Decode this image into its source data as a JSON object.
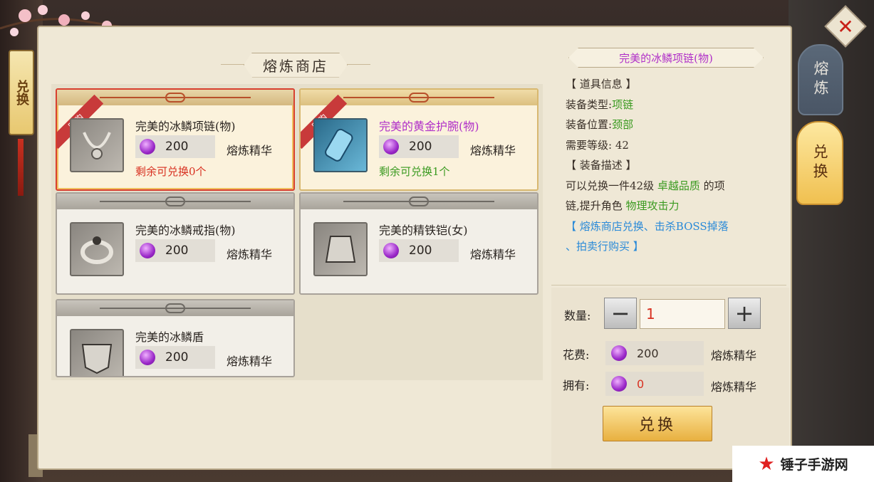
{
  "shop": {
    "title": "熔炼商店",
    "limited_tag": "限购",
    "items": [
      {
        "name": "完美的冰鳞项链(物)",
        "price": "200",
        "currency": "熔炼精华",
        "remaining": "剩余可兑换0个",
        "limited": true,
        "selected": true,
        "name_color": "normal",
        "remain_color": "red"
      },
      {
        "name": "完美的黄金护腕(物)",
        "price": "200",
        "currency": "熔炼精华",
        "remaining": "剩余可兑换1个",
        "limited": true,
        "selected": false,
        "name_color": "purple",
        "remain_color": "green"
      },
      {
        "name": "完美的冰鳞戒指(物)",
        "price": "200",
        "currency": "熔炼精华",
        "remaining": "",
        "limited": false
      },
      {
        "name": "完美的精铁铠(女)",
        "price": "200",
        "currency": "熔炼精华",
        "remaining": "",
        "limited": false
      },
      {
        "name": "完美的冰鳞盾",
        "price": "200",
        "currency": "熔炼精华",
        "remaining": "",
        "limited": false
      }
    ]
  },
  "detail": {
    "item_title": "完美的冰鳞项链(物)",
    "info_header": "【 道具信息 】",
    "type_label": "装备类型:",
    "type_value": "项链",
    "slot_label": "装备位置:",
    "slot_value": "颈部",
    "level_text": "需要等级: 42",
    "desc_header": "【 装备描述 】",
    "desc_part1": "可以兑换一件42级 ",
    "desc_quality": "卓越品质",
    "desc_part2": " 的项",
    "desc_part3": "链,提升角色 ",
    "desc_attr": "物理攻击力",
    "source_line1": "【 熔炼商店兑换、击杀BOSS掉落",
    "source_line2": "、拍卖行购买 】"
  },
  "purchase": {
    "qty_label": "数量:",
    "qty_value": "1",
    "minus": "−",
    "plus": "+",
    "cost_label": "花费:",
    "cost_value": "200",
    "cost_currency": "熔炼精华",
    "own_label": "拥有:",
    "own_value": "0",
    "own_currency": "熔炼精华",
    "exchange_button": "兑换"
  },
  "tabs": {
    "smelt": "熔炼",
    "exchange": "兑换",
    "left_tab": "兑换"
  },
  "close_symbol": "✕",
  "watermark": {
    "text": "锤子手游网"
  },
  "colors": {
    "purple": "#b030c8",
    "green": "#3a9a20",
    "red": "#d83020",
    "blue": "#2a8ad8"
  }
}
